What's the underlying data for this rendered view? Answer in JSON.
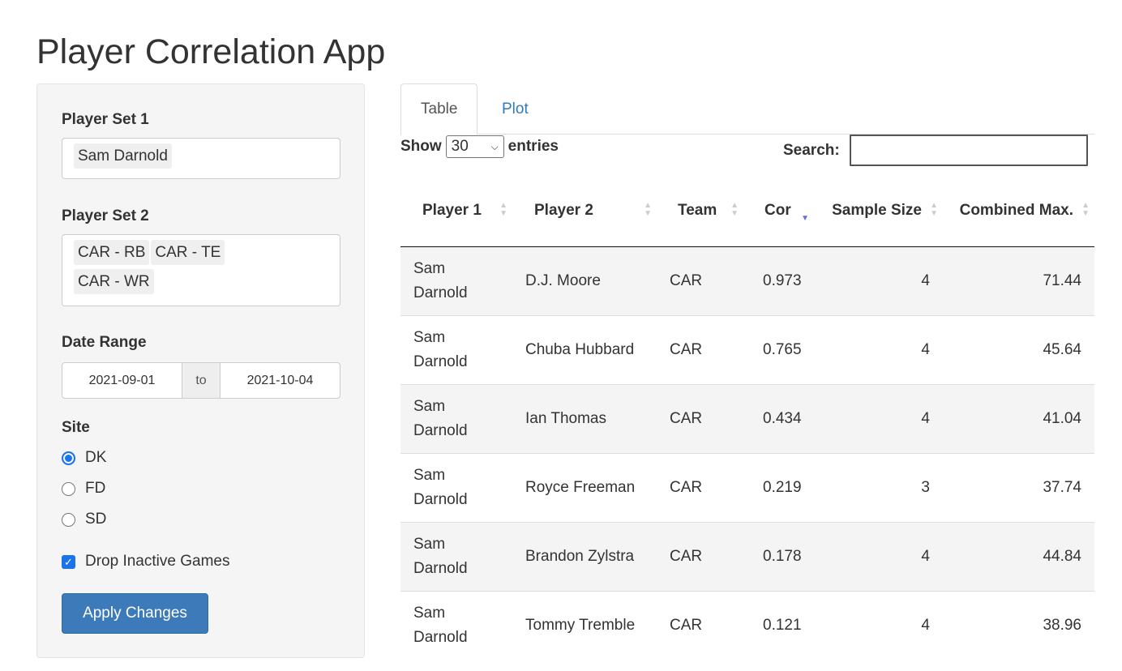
{
  "title": "Player Correlation App",
  "sidebar": {
    "player_set_1": {
      "label": "Player Set 1",
      "selected": [
        "Sam Darnold"
      ]
    },
    "player_set_2": {
      "label": "Player Set 2",
      "selected": [
        "CAR - RB",
        "CAR - TE",
        "CAR - WR"
      ]
    },
    "date_range": {
      "label": "Date Range",
      "start": "2021-09-01",
      "separator": "to",
      "end": "2021-10-04"
    },
    "site": {
      "label": "Site",
      "options": [
        "DK",
        "FD",
        "SD"
      ],
      "selected": "DK"
    },
    "drop_inactive": {
      "label": "Drop Inactive Games",
      "checked": true
    },
    "apply_label": "Apply Changes"
  },
  "tabs": [
    {
      "label": "Table",
      "active": true
    },
    {
      "label": "Plot",
      "active": false
    }
  ],
  "table": {
    "show_label": "Show",
    "entries_value": "30",
    "entries_label": "entries",
    "search_label": "Search:",
    "search_value": "",
    "columns": [
      "Player 1",
      "Player 2",
      "Team",
      "Cor",
      "Sample Size",
      "Combined Max."
    ],
    "sort": {
      "column": "Cor",
      "direction": "desc",
      "color": "#6b6bda"
    },
    "rows": [
      [
        "Sam Darnold",
        "D.J. Moore",
        "CAR",
        "0.973",
        "4",
        "71.44"
      ],
      [
        "Sam Darnold",
        "Chuba Hubbard",
        "CAR",
        "0.765",
        "4",
        "45.64"
      ],
      [
        "Sam Darnold",
        "Ian Thomas",
        "CAR",
        "0.434",
        "4",
        "41.04"
      ],
      [
        "Sam Darnold",
        "Royce Freeman",
        "CAR",
        "0.219",
        "3",
        "37.74"
      ],
      [
        "Sam Darnold",
        "Brandon Zylstra",
        "CAR",
        "0.178",
        "4",
        "44.84"
      ],
      [
        "Sam Darnold",
        "Tommy Tremble",
        "CAR",
        "0.121",
        "4",
        "38.96"
      ]
    ]
  },
  "colors": {
    "accent": "#337ab7",
    "button": "#3c7ab9"
  }
}
